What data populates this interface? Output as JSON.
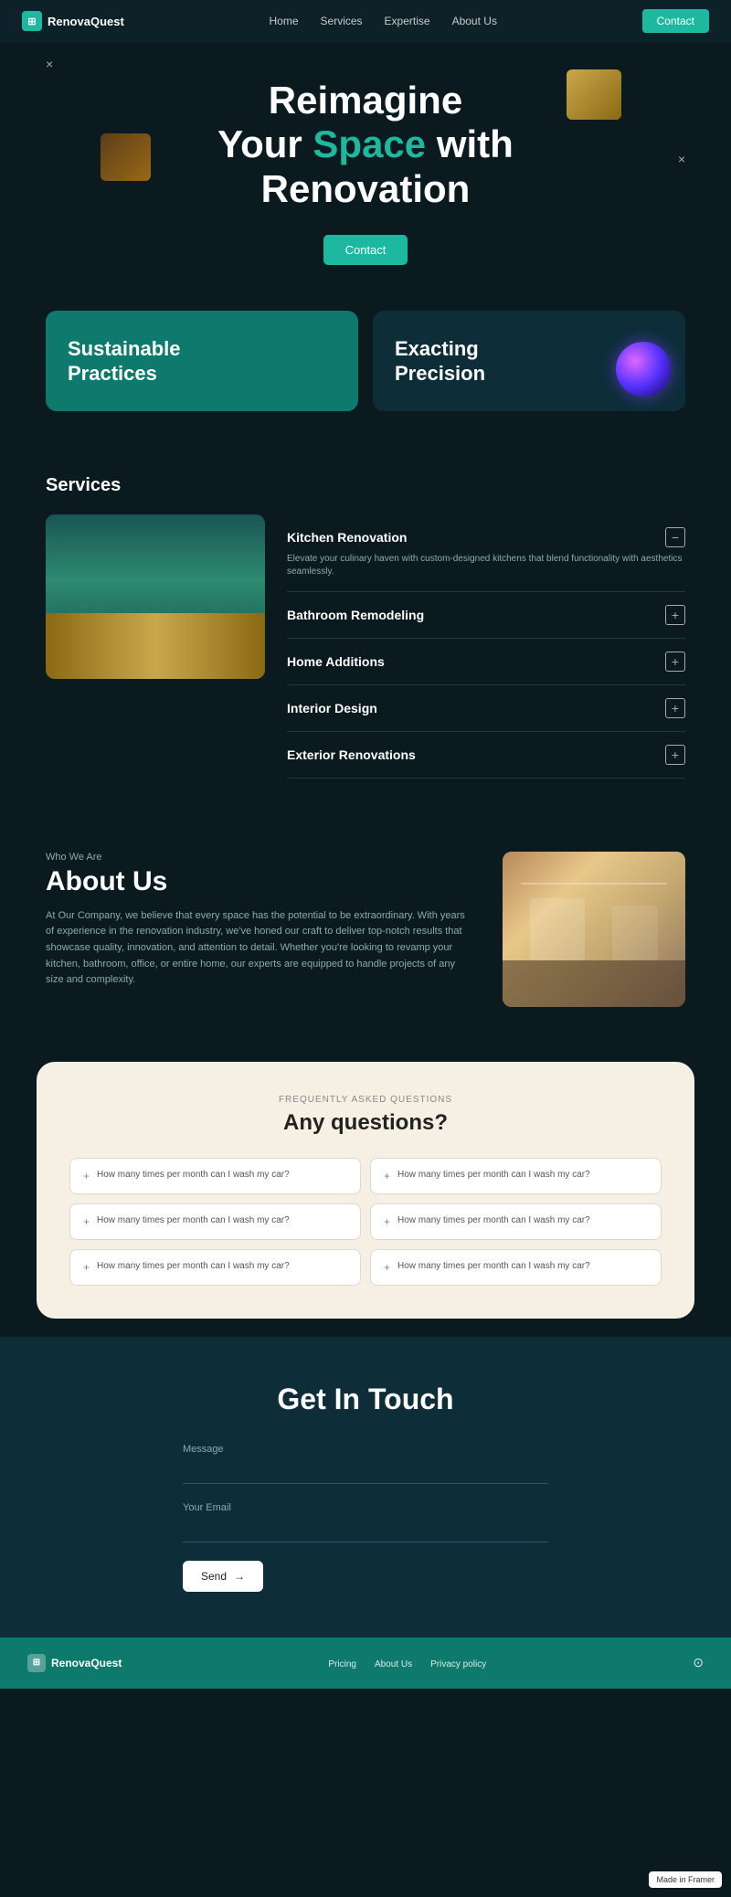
{
  "nav": {
    "logo": "RenovaQuest",
    "links": [
      "Home",
      "Services",
      "Expertise",
      "About Us"
    ],
    "contact_btn": "Contact"
  },
  "hero": {
    "line1": "Reimagine",
    "line2_before": "Your ",
    "line2_accent": "Space",
    "line2_after": " with",
    "line3": "Renovation",
    "contact_btn": "Contact",
    "close1": "×",
    "close2": "×"
  },
  "features": [
    {
      "title": "Sustainable\nPractices",
      "style": "green",
      "has_orb": false
    },
    {
      "title": "Exacting\nPrecision",
      "style": "dark",
      "has_orb": true
    }
  ],
  "services": {
    "section_title": "Services",
    "items": [
      {
        "name": "Kitchen Renovation",
        "expanded": true,
        "desc": "Elevate your culinary haven with custom-designed kitchens that blend functionality with aesthetics seamlessly.",
        "icon": "−"
      },
      {
        "name": "Bathroom Remodeling",
        "expanded": false,
        "desc": "",
        "icon": "+"
      },
      {
        "name": "Home Additions",
        "expanded": false,
        "desc": "",
        "icon": "+"
      },
      {
        "name": "Interior Design",
        "expanded": false,
        "desc": "",
        "icon": "+"
      },
      {
        "name": "Exterior Renovations",
        "expanded": false,
        "desc": "",
        "icon": "+"
      }
    ]
  },
  "about": {
    "label": "Who We Are",
    "title": "About Us",
    "body": "At Our Company, we believe that every space has the potential to be extraordinary. With years of experience in the renovation industry, we've honed our craft to deliver top-notch results that showcase quality, innovation, and attention to detail. Whether you're looking to revamp your kitchen, bathroom, office, or entire home, our experts are equipped to handle projects of any size and complexity."
  },
  "faq": {
    "section_label": "FREQUENTLY ASKED QUESTIONS",
    "title": "Any questions?",
    "items": [
      "How many times per month can I wash my car?",
      "How many times per month can I wash my car?",
      "How many times per month can I wash my car?",
      "How many times per month can I wash my car?",
      "How many times per month can I wash my car?",
      "How many times per month can I wash my car?"
    ]
  },
  "contact": {
    "title": "Get In Touch",
    "message_label": "Message",
    "email_label": "Your Email",
    "send_btn": "Send",
    "arrow": "→"
  },
  "footer": {
    "logo": "RenovaQuest",
    "links": [
      "Pricing",
      "About Us",
      "Privacy policy"
    ],
    "social_icon": "⊙"
  }
}
